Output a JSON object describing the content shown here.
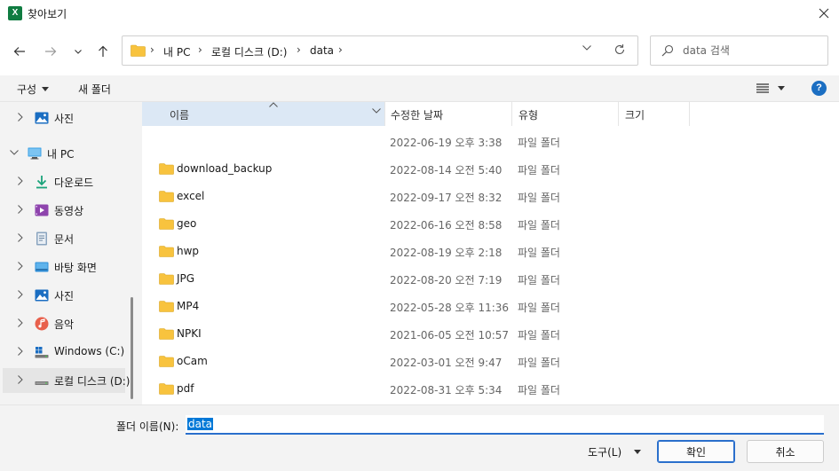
{
  "window": {
    "title": "찾아보기",
    "app_icon_letter": "X"
  },
  "address": {
    "crumbs": [
      "내 PC",
      "로컬 디스크 (D:)",
      "data"
    ],
    "separator": "›"
  },
  "search": {
    "placeholder": "data 검색"
  },
  "toolbar": {
    "organize_label": "구성",
    "new_folder_label": "새 폴더",
    "help_label": "?"
  },
  "sidebar": {
    "items": [
      {
        "label": "사진",
        "icon": "photos-icon",
        "level": 1
      },
      {
        "label": "내 PC",
        "icon": "pc-icon",
        "level": 0,
        "expanded": true
      },
      {
        "label": "다운로드",
        "icon": "download-icon",
        "level": 1
      },
      {
        "label": "동영상",
        "icon": "videos-icon",
        "level": 1
      },
      {
        "label": "문서",
        "icon": "documents-icon",
        "level": 1
      },
      {
        "label": "바탕 화면",
        "icon": "desktop-icon",
        "level": 1
      },
      {
        "label": "사진",
        "icon": "photos-icon",
        "level": 1
      },
      {
        "label": "음악",
        "icon": "music-icon",
        "level": 1
      },
      {
        "label": "Windows (C:)",
        "icon": "windows-drive-icon",
        "level": 1
      },
      {
        "label": "로컬 디스크 (D:)",
        "icon": "drive-icon",
        "level": 1,
        "selected": true
      }
    ]
  },
  "columns": {
    "name": "이름",
    "date": "수정한 날짜",
    "type": "유형",
    "size": "크기"
  },
  "files": [
    {
      "name": "",
      "date": "2022-06-19 오후 3:38",
      "type": "파일 폴더"
    },
    {
      "name": "download_backup",
      "date": "2022-08-14 오전 5:40",
      "type": "파일 폴더"
    },
    {
      "name": "excel",
      "date": "2022-09-17 오전 8:32",
      "type": "파일 폴더"
    },
    {
      "name": "geo",
      "date": "2022-06-16 오전 8:58",
      "type": "파일 폴더"
    },
    {
      "name": "hwp",
      "date": "2022-08-19 오후 2:18",
      "type": "파일 폴더"
    },
    {
      "name": "JPG",
      "date": "2022-08-20 오전 7:19",
      "type": "파일 폴더"
    },
    {
      "name": "MP4",
      "date": "2022-05-28 오후 11:36",
      "type": "파일 폴더"
    },
    {
      "name": "NPKI",
      "date": "2021-06-05 오전 10:57",
      "type": "파일 폴더"
    },
    {
      "name": "oCam",
      "date": "2022-03-01 오전 9:47",
      "type": "파일 폴더"
    },
    {
      "name": "pdf",
      "date": "2022-08-31 오후 5:34",
      "type": "파일 폴더"
    }
  ],
  "footer": {
    "folder_name_label": "폴더 이름(N):",
    "folder_name_value": "data",
    "tools_label": "도구(L)",
    "open_label": "확인",
    "cancel_label": "취소"
  },
  "colors": {
    "accent": "#0078d7",
    "folder": "#f8c33e",
    "header_selected": "#dce8f5"
  }
}
